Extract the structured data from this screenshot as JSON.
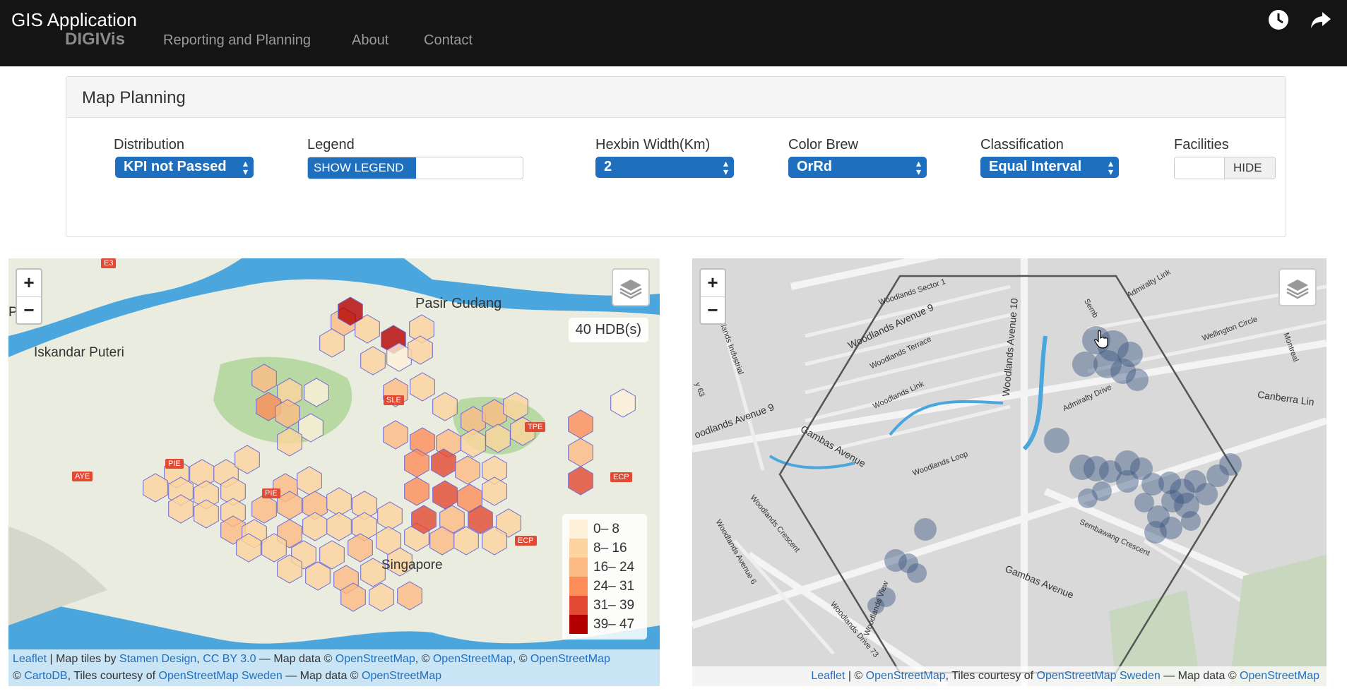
{
  "overlay": {
    "title": "GIS Application",
    "icons": [
      "clock-icon",
      "share-icon"
    ]
  },
  "nav": {
    "brand": "DIGIVis",
    "items": [
      "Reporting and Planning",
      "About",
      "Contact"
    ]
  },
  "panel": {
    "title": "Map Planning",
    "distribution": {
      "label": "Distribution",
      "value": "KPI not Passed"
    },
    "legend": {
      "label": "Legend",
      "value": "SHOW LEGEND"
    },
    "hexbin": {
      "label": "Hexbin Width(Km)",
      "value": "2"
    },
    "colorbrew": {
      "label": "Color Brew",
      "value": "OrRd"
    },
    "classification": {
      "label": "Classification",
      "value": "Equal Interval"
    },
    "facilities": {
      "label": "Facilities",
      "value": "HIDE"
    }
  },
  "left_map": {
    "zoom_in": "+",
    "zoom_out": "−",
    "info": "40 HDB(s)",
    "places": [
      "Pasir Gudang",
      "Iskandar Puteri",
      "Singapore",
      "Pa"
    ],
    "roads": [
      "E3",
      "SLE",
      "TPE",
      "AYE",
      "PIE",
      "ECP",
      "ECP",
      "PIE"
    ],
    "legend": [
      {
        "label": "0– 8",
        "color": "#fef0d9"
      },
      {
        "label": "8– 16",
        "color": "#fdd49e"
      },
      {
        "label": "16– 24",
        "color": "#fdbb84"
      },
      {
        "label": "24– 31",
        "color": "#fc8d59"
      },
      {
        "label": "31– 39",
        "color": "#e34a33"
      },
      {
        "label": "39– 47",
        "color": "#b30000"
      }
    ],
    "attribution_line1": {
      "leaflet": "Leaflet",
      "t1": " | Map tiles by ",
      "stamen": "Stamen Design",
      "t2": ", ",
      "cc": "CC BY 3.0",
      "t3": " — Map data © ",
      "osm1": "OpenStreetMap",
      "t4": ", © ",
      "osm2": "OpenStreetMap",
      "t5": ", © ",
      "osm3": "OpenStreetMap"
    },
    "attribution_line2": {
      "t1": "© ",
      "carto": "CartoDB",
      "t2": ", Tiles courtesy of ",
      "osmse": "OpenStreetMap Sweden",
      "t3": " — Map data © ",
      "osm": "OpenStreetMap"
    }
  },
  "right_map": {
    "zoom_in": "+",
    "zoom_out": "−",
    "streets": [
      "Woodlands Sector 1",
      "Woodlands Avenue 9",
      "Woodlands Terrace",
      "Woodlands Link",
      "Woodlands Avenue 10",
      "Admiralty Drive",
      "Wellington Circle",
      "Canberra Lin",
      "Gambas Avenue",
      "Woodlands Loop",
      "Woodlands Crescent",
      "Sembawang Crescent",
      "Gambas Avenue",
      "Woodlands View",
      "Woodlands Drive 73",
      "Woodlands Avenue 6",
      "oodlands Avenue 9",
      "Montreal",
      "Woodlands Industrial",
      "Semb",
      "Admiralty Link",
      "y 63"
    ],
    "attribution": {
      "leaflet": "Leaflet",
      "t1": " | © ",
      "osm1": "OpenStreetMap",
      "t2": ", Tiles courtesy of ",
      "osmse": "OpenStreetMap Sweden",
      "t3": " — Map data © ",
      "osm2": "OpenStreetMap"
    }
  }
}
